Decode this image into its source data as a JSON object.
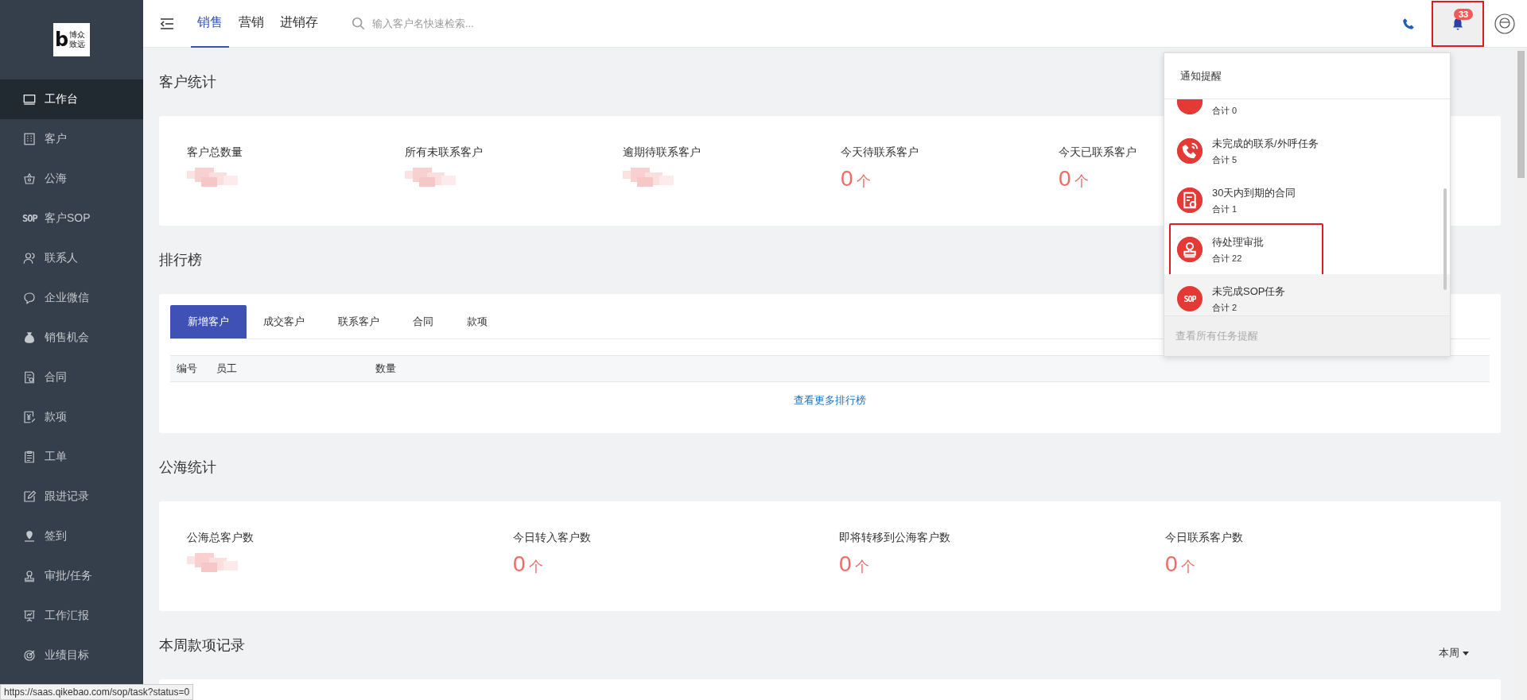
{
  "sidebar": {
    "logo": {
      "mark": "b",
      "lines": [
        "博众",
        "致远"
      ]
    },
    "items": [
      {
        "label": "工作台",
        "selected": true
      },
      {
        "label": "客户",
        "selected": false
      },
      {
        "label": "公海",
        "selected": false
      },
      {
        "label": "客户SOP",
        "selected": false,
        "icon_text": "SOP"
      },
      {
        "label": "联系人",
        "selected": false
      },
      {
        "label": "企业微信",
        "selected": false
      },
      {
        "label": "销售机会",
        "selected": false
      },
      {
        "label": "合同",
        "selected": false
      },
      {
        "label": "款项",
        "selected": false
      },
      {
        "label": "工单",
        "selected": false
      },
      {
        "label": "跟进记录",
        "selected": false
      },
      {
        "label": "签到",
        "selected": false
      },
      {
        "label": "审批/任务",
        "selected": false
      },
      {
        "label": "工作汇报",
        "selected": false
      },
      {
        "label": "业绩目标",
        "selected": false
      }
    ]
  },
  "topbar": {
    "tabs": [
      {
        "label": "销售",
        "selected": true
      },
      {
        "label": "营销",
        "selected": false
      },
      {
        "label": "进销存",
        "selected": false
      }
    ],
    "search": {
      "placeholder": "输入客户名快速检索..."
    },
    "notifications": {
      "badge": "33",
      "highlighted": true
    }
  },
  "customer_stats": {
    "title": "客户统计",
    "stats": [
      {
        "label": "客户总数量",
        "redacted": true
      },
      {
        "label": "所有未联系客户",
        "redacted": true
      },
      {
        "label": "逾期待联系客户",
        "redacted": true
      },
      {
        "label": "今天待联系客户",
        "redacted": false,
        "value": "0",
        "unit": "个"
      },
      {
        "label": "今天已联系客户",
        "redacted": false,
        "value": "0",
        "unit": "个"
      }
    ]
  },
  "ranking": {
    "title": "排行榜",
    "tabs": [
      {
        "label": "新增客户",
        "selected": true
      },
      {
        "label": "成交客户",
        "selected": false
      },
      {
        "label": "联系客户",
        "selected": false
      },
      {
        "label": "合同",
        "selected": false
      },
      {
        "label": "款项",
        "selected": false
      }
    ],
    "columns": [
      "编号",
      "员工",
      "数量"
    ],
    "more_link": "查看更多排行榜"
  },
  "pool_stats": {
    "title": "公海统计",
    "stats": [
      {
        "label": "公海总客户数",
        "redacted": true
      },
      {
        "label": "今日转入客户数",
        "redacted": false,
        "value": "0",
        "unit": "个"
      },
      {
        "label": "即将转移到公海客户数",
        "redacted": false,
        "value": "0",
        "unit": "个"
      },
      {
        "label": "今日联系客户数",
        "redacted": false,
        "value": "0",
        "unit": "个"
      }
    ]
  },
  "weekly_payments": {
    "title": "本周款项记录",
    "period": "本周"
  },
  "notification_panel": {
    "title": "通知提醒",
    "items": [
      {
        "kind": "unknown",
        "count": "合计 0",
        "highlighted": false,
        "hovered": false
      },
      {
        "kind": "phone",
        "title": "未完成的联系/外呼任务",
        "count": "合计 5",
        "highlighted": false,
        "hovered": false
      },
      {
        "kind": "contract",
        "title": "30天内到期的合同",
        "count": "合计 1",
        "highlighted": false,
        "hovered": false
      },
      {
        "kind": "stamp",
        "title": "待处理审批",
        "count": "合计 22",
        "highlighted": true,
        "hovered": false
      },
      {
        "kind": "sop",
        "icon_text": "SOP",
        "title": "未完成SOP任务",
        "count": "合计 2",
        "highlighted": false,
        "hovered": true
      }
    ],
    "footer": "查看所有任务提醒"
  },
  "status_bar": {
    "url": "https://saas.qikebao.com/sop/task?status=0"
  }
}
